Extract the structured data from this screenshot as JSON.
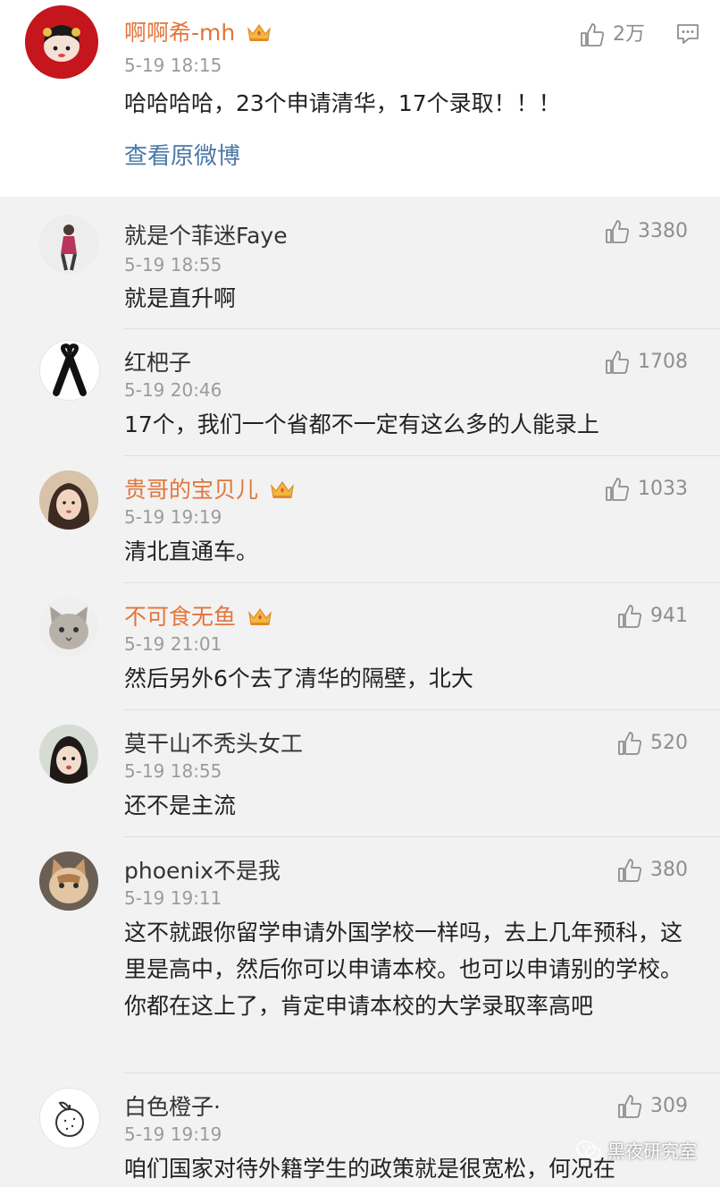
{
  "original_post": {
    "username": "啊啊希-mh",
    "timestamp": "5-19 18:15",
    "text": "哈哈哈哈，23个申请清华，17个录取！！！",
    "likes": "2万",
    "view_original_label": "查看原微博"
  },
  "comments": [
    {
      "username": "就是个菲迷Faye",
      "timestamp": "5-19 18:55",
      "text": "就是直升啊",
      "likes": "3380",
      "vip": false
    },
    {
      "username": "红杷子",
      "timestamp": "5-19 20:46",
      "text": "17个，我们一个省都不一定有这么多的人能录上",
      "likes": "1708",
      "vip": false
    },
    {
      "username": "贵哥的宝贝儿",
      "timestamp": "5-19 19:19",
      "text": "清北直通车。",
      "likes": "1033",
      "vip": true
    },
    {
      "username": "不可食无鱼",
      "timestamp": "5-19 21:01",
      "text": "然后另外6个去了清华的隔壁，北大",
      "likes": "941",
      "vip": true
    },
    {
      "username": "莫干山不秃头女工",
      "timestamp": "5-19 18:55",
      "text": "还不是主流",
      "likes": "520",
      "vip": false
    },
    {
      "username": "phoenix不是我",
      "timestamp": "5-19 19:11",
      "text": "这不就跟你留学申请外国学校一样吗，去上几年预科，这里是高中，然后你可以申请本校。也可以申请别的学校。你都在这上了，肯定申请本校的大学录取率高吧",
      "likes": "380",
      "vip": false
    },
    {
      "username": "白色橙子·",
      "timestamp": "5-19 19:19",
      "text": "咱们国家对待外籍学生的政策就是很宽松，何况在",
      "likes": "309",
      "vip": false
    }
  ],
  "watermark": "黑夜研究室",
  "colors": {
    "vip_name": "#e3753b",
    "link": "#4b78a8",
    "timestamp": "#9b9b9b"
  }
}
